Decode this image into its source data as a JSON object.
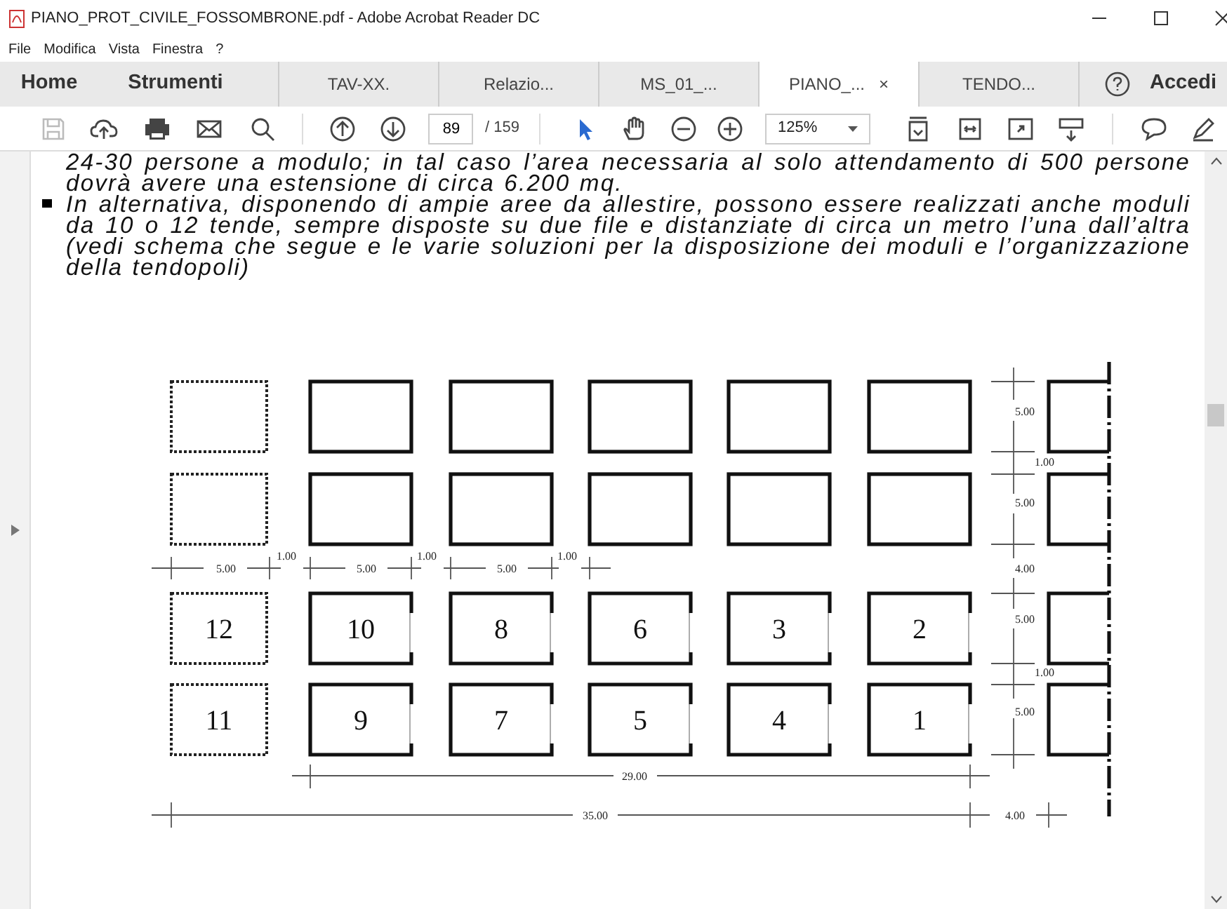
{
  "window": {
    "title": "PIANO_PROT_CIVILE_FOSSOMBRONE.pdf - Adobe Acrobat Reader DC"
  },
  "menu": [
    "File",
    "Modifica",
    "Vista",
    "Finestra",
    "?"
  ],
  "nav": [
    "Home",
    "Strumenti"
  ],
  "tabs": [
    {
      "label": "TAV-XX.",
      "selected": false
    },
    {
      "label": "Relazio...",
      "selected": false
    },
    {
      "label": "MS_01_...",
      "selected": false
    },
    {
      "label": "PIANO_...",
      "selected": true
    },
    {
      "label": "TENDO...",
      "selected": false
    }
  ],
  "tab_close": "×",
  "account": "Accedi",
  "toolbar": {
    "page": "89",
    "page_count": "/ 159",
    "zoom": "125%"
  },
  "document": {
    "paragraphs": [
      {
        "bullet": false,
        "text": "24-30 persone a modulo; in tal caso l’area necessaria al solo attendamento di 500 persone dovrà avere una estensione di circa 6.200 mq."
      },
      {
        "bullet": true,
        "text": " In alternativa, disponendo di ampie aree da allestire, possono essere realizzati anche moduli da 10 o 12 tende, sempre disposte su due file e distanziate di circa un metro l’una dall’altra (vedi schema che segue e le varie soluzioni per la disposizione dei moduli e l’organizzazione della tendopoli)"
      }
    ],
    "diagram": {
      "rows": [
        [
          {
            "kind": "reserve"
          },
          {
            "kind": "tent"
          },
          {
            "kind": "tent"
          },
          {
            "kind": "tent"
          },
          {
            "kind": "tent"
          },
          {
            "kind": "tent"
          }
        ],
        [
          {
            "kind": "reserve"
          },
          {
            "kind": "tent"
          },
          {
            "kind": "tent"
          },
          {
            "kind": "tent"
          },
          {
            "kind": "tent"
          },
          {
            "kind": "tent"
          }
        ],
        [
          {
            "kind": "reserve",
            "label": "12"
          },
          {
            "kind": "door",
            "label": "10"
          },
          {
            "kind": "door",
            "label": "8"
          },
          {
            "kind": "door",
            "label": "6"
          },
          {
            "kind": "door",
            "label": "3"
          },
          {
            "kind": "door",
            "label": "2"
          }
        ],
        [
          {
            "kind": "reserve",
            "label": "11"
          },
          {
            "kind": "door",
            "label": "9"
          },
          {
            "kind": "door",
            "label": "7"
          },
          {
            "kind": "door",
            "label": "5"
          },
          {
            "kind": "door",
            "label": "4"
          },
          {
            "kind": "door",
            "label": "1"
          }
        ]
      ],
      "column_dims": [
        "5.00",
        "1.00",
        "5.00",
        "1.00",
        "5.00",
        "1.00"
      ],
      "row_dims": [
        "5.00",
        "1.00",
        "5.00",
        "4.00",
        "5.00",
        "1.00",
        "5.00"
      ],
      "total_dims": [
        "29.00",
        "35.00",
        "4.00"
      ]
    }
  }
}
